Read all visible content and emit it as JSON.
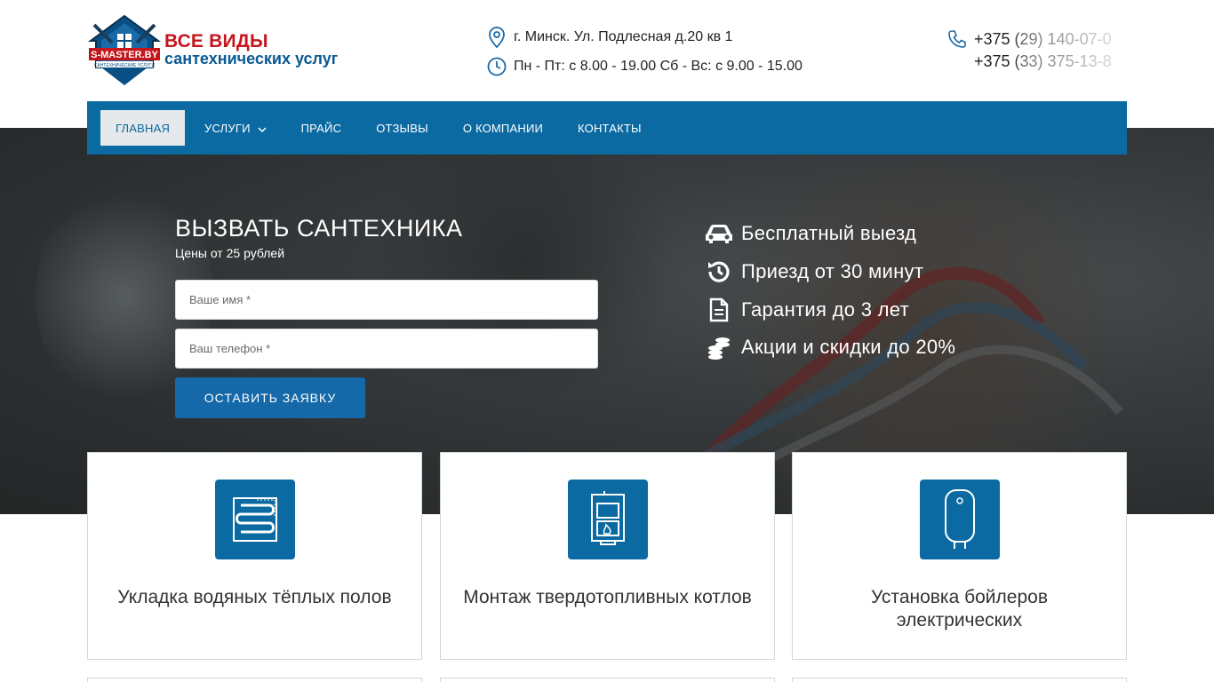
{
  "brand": {
    "logo_text": "S-MASTER.BY",
    "logo_sub": "САНТЕХНИЧЕСКИЕ УСЛУГИ",
    "title": "ВСЕ ВИДЫ",
    "subtitle": "сантехнических услуг"
  },
  "contacts": {
    "address": "г. Минск. Ул. Подлесная д.20 кв 1",
    "hours": "Пн - Пт: с 8.00 - 19.00 Сб - Вс: с 9.00 - 15.00",
    "phone1": "+375 (29) 140-07-0",
    "phone2": "+375 (33) 375-13-8"
  },
  "nav": {
    "items": [
      {
        "label": "ГЛАВНАЯ",
        "active": true
      },
      {
        "label": "УСЛУГИ",
        "dropdown": true
      },
      {
        "label": "ПРАЙС"
      },
      {
        "label": "ОТЗЫВЫ"
      },
      {
        "label": "О КОМПАНИИ"
      },
      {
        "label": "КОНТАКТЫ"
      }
    ]
  },
  "hero": {
    "title": "ВЫЗВАТЬ САНТЕХНИКА",
    "subtitle": "Цены от 25 рублей",
    "name_placeholder": "Ваше имя *",
    "phone_placeholder": "Ваш телефон *",
    "submit_label": "ОСТАВИТЬ ЗАЯВКУ",
    "features": [
      {
        "icon": "car-icon",
        "text": "Бесплатный выезд"
      },
      {
        "icon": "history-icon",
        "text": "Приезд от 30 минут"
      },
      {
        "icon": "document-icon",
        "text": "Гарантия до 3 лет"
      },
      {
        "icon": "coins-icon",
        "text": "Акции и скидки до 20%"
      }
    ]
  },
  "services": [
    {
      "icon": "underfloor-heating-icon",
      "title": "Укладка водяных тёплых полов"
    },
    {
      "icon": "solid-fuel-boiler-icon",
      "title": "Монтаж твердотопливных котлов"
    },
    {
      "icon": "water-heater-icon",
      "title": "Установка бойлеров электрических"
    }
  ],
  "colors": {
    "brand_blue": "#0b6aa1",
    "brand_red": "#c4161c",
    "button_blue": "#1569a8"
  }
}
